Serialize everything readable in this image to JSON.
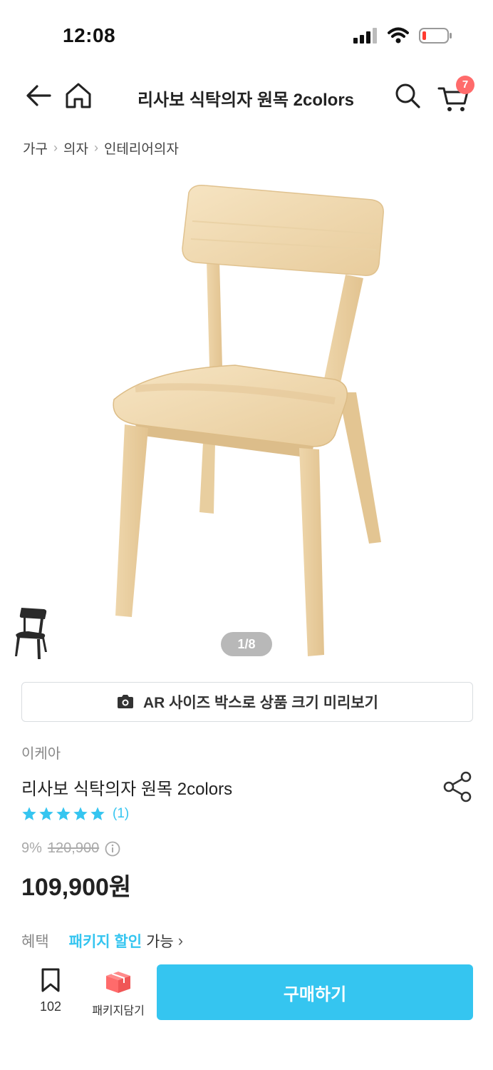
{
  "status_bar": {
    "time": "12:08"
  },
  "nav": {
    "title": "리사보 식탁의자 원목 2colors",
    "cart_count": "7"
  },
  "breadcrumb": [
    "가구",
    "의자",
    "인테리어의자"
  ],
  "gallery": {
    "page_indicator": "1/8"
  },
  "ar_button": {
    "label": "AR 사이즈 박스로 상품 크기 미리보기"
  },
  "product": {
    "brand": "이케아",
    "name": "리사보 식탁의자 원목 2colors",
    "rating": 5,
    "review_count": "(1)",
    "discount_rate": "9%",
    "original_price": "120,900",
    "price": "109,900원"
  },
  "benefit": {
    "label": "혜택",
    "highlight": "패키지 할인",
    "suffix": "가능"
  },
  "bottom_bar": {
    "bookmark_count": "102",
    "package_label": "패키지담기",
    "buy_label": "구매하기"
  },
  "colors": {
    "accent": "#35c5f0",
    "badge": "#ff6b6b",
    "wood": "#f0dab2"
  }
}
